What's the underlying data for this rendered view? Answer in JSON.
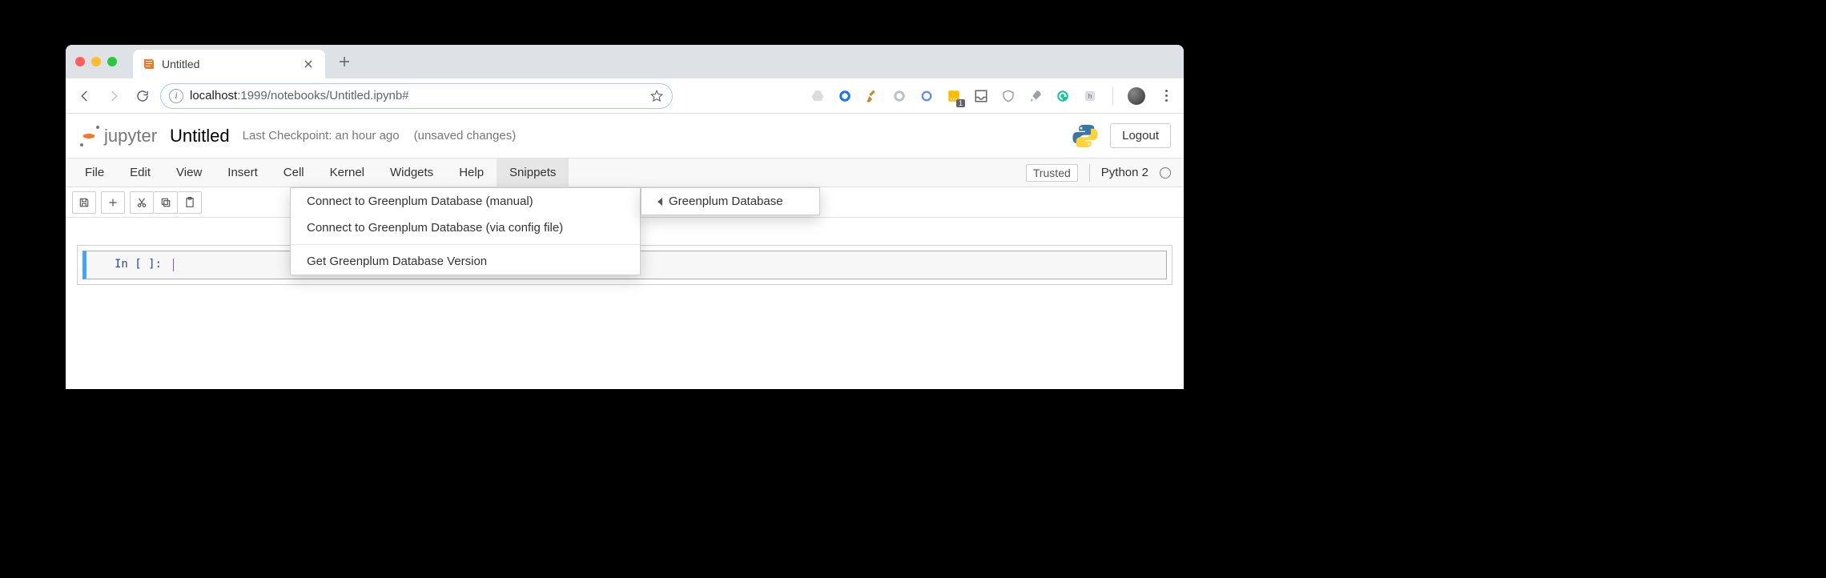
{
  "browser": {
    "tab_title": "Untitled",
    "url_host": "localhost",
    "url_port_path": ":1999/notebooks/Untitled.ipynb#"
  },
  "extensions": {
    "badge1": "1"
  },
  "jupyter": {
    "logo_text": "jupyter",
    "notebook_title": "Untitled",
    "checkpoint": "Last Checkpoint: an hour ago",
    "unsaved": "(unsaved changes)",
    "logout": "Logout"
  },
  "menubar": {
    "items": [
      "File",
      "Edit",
      "View",
      "Insert",
      "Cell",
      "Kernel",
      "Widgets",
      "Help",
      "Snippets"
    ],
    "trusted": "Trusted",
    "kernel": "Python 2"
  },
  "snippets_menu": {
    "items": [
      "Connect to Greenplum Database (manual)",
      "Connect to Greenplum Database (via config file)"
    ],
    "items2": [
      "Get Greenplum Database Version"
    ],
    "submenu_label": "Greenplum Database"
  },
  "cell": {
    "prompt": "In [ ]:"
  }
}
